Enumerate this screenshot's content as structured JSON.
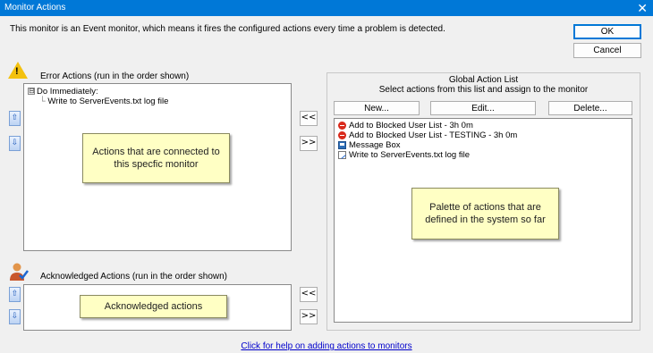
{
  "window": {
    "title": "Monitor Actions",
    "close_glyph": "✕"
  },
  "description": "This monitor is an Event monitor, which means it fires the configured actions every time a problem is detected.",
  "buttons": {
    "ok": "OK",
    "cancel": "Cancel",
    "new": "New...",
    "edit": "Edit...",
    "delete": "Delete..."
  },
  "error_actions": {
    "label": "Error Actions (run in the order shown)",
    "tree": {
      "group": "Do Immediately:",
      "expander": "⊟",
      "children": [
        "Write to ServerEvents.txt log file"
      ]
    },
    "callout": "Actions that are connected to this specfic monitor"
  },
  "ack_actions": {
    "label": "Acknowledged Actions (run in the order shown)",
    "callout": "Acknowledged actions"
  },
  "transfer": {
    "assign": "<<",
    "remove": ">>"
  },
  "move_glyphs": {
    "up": "⇧",
    "down": "⇩"
  },
  "global_list": {
    "title": "Global Action List",
    "subtitle": "Select actions from this list and assign to the monitor",
    "items": [
      {
        "label": "Add to Blocked User List - 3h 0m",
        "icon": "block-icon"
      },
      {
        "label": "Add to Blocked User List - TESTING - 3h 0m",
        "icon": "block-icon"
      },
      {
        "label": "Message Box",
        "icon": "message-box-icon"
      },
      {
        "label": "Write to ServerEvents.txt log file",
        "icon": "write-log-icon"
      }
    ],
    "callout": "Palette of actions that are defined in the system so far"
  },
  "help_link": "Click for help on adding actions to monitors",
  "colors": {
    "titlebar": "#0078d7",
    "callout_bg": "#ffffc4",
    "link": "#0000cc"
  }
}
